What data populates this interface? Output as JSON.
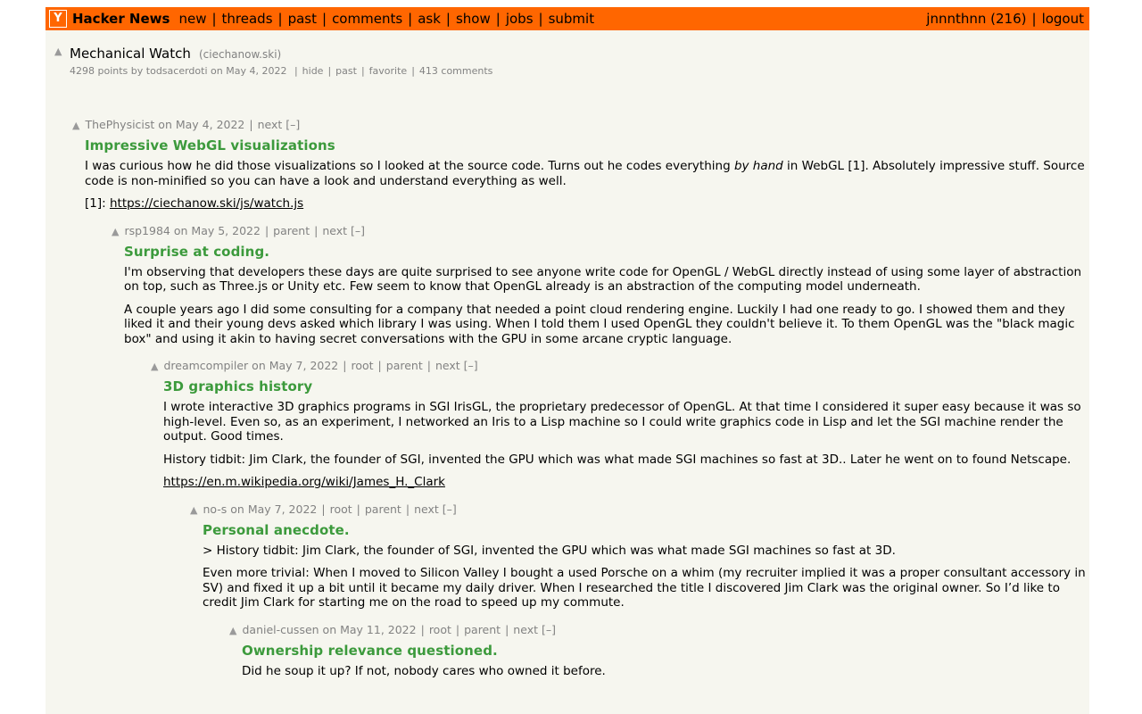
{
  "header": {
    "logo": "Y",
    "site_name": "Hacker News",
    "nav": [
      "new",
      "threads",
      "past",
      "comments",
      "ask",
      "show",
      "jobs",
      "submit"
    ],
    "user": "jnnnthnn (216)",
    "logout": "logout"
  },
  "story": {
    "title": "Mechanical Watch",
    "site": "(ciechanow.ski)",
    "points": "4298 points",
    "by_label": "by",
    "author": "todsacerdoti",
    "on_label": "on",
    "date": "May 4, 2022",
    "links": [
      "hide",
      "past",
      "favorite",
      "413 comments"
    ]
  },
  "comments": [
    {
      "author": "ThePhysicist",
      "date": "May 4, 2022",
      "links": [
        "next"
      ],
      "collapse": "[–]",
      "title": "Impressive WebGL visualizations",
      "paragraphs": [
        [
          {
            "t": "I was curious how he did those visualizations so I looked at the source code. Turns out he codes everything "
          },
          {
            "t": "by hand",
            "em": true
          },
          {
            "t": " in WebGL [1]. Absolutely impressive stuff. Source code is non-minified so you can have a look and understand everything as well."
          }
        ],
        [
          {
            "t": "[1]: "
          },
          {
            "t": "https://ciechanow.ski/js/watch.js",
            "link": true
          }
        ]
      ]
    },
    {
      "author": "rsp1984",
      "date": "May 5, 2022",
      "links": [
        "parent",
        "next"
      ],
      "collapse": "[–]",
      "title": "Surprise at coding.",
      "paragraphs": [
        [
          {
            "t": "I'm observing that developers these days are quite surprised to see anyone write code for OpenGL / WebGL directly instead of using some layer of abstraction on top, such as Three.js or Unity etc. Few seem to know that OpenGL already is an abstraction of the computing model underneath."
          }
        ],
        [
          {
            "t": "A couple years ago I did some consulting for a company that needed a point cloud rendering engine. Luckily I had one ready to go. I showed them and they liked it and their young devs asked which library I was using. When I told them I used OpenGL they couldn't believe it. To them OpenGL was the \"black magic box\" and using it akin to having secret conversations with the GPU in some arcane cryptic language."
          }
        ]
      ]
    },
    {
      "author": "dreamcompiler",
      "date": "May 7, 2022",
      "links": [
        "root",
        "parent",
        "next"
      ],
      "collapse": "[–]",
      "title": "3D graphics history",
      "paragraphs": [
        [
          {
            "t": "I wrote interactive 3D graphics programs in SGI IrisGL, the proprietary predecessor of OpenGL. At that time I considered it super easy because it was so high-level. Even so, as an experiment, I networked an Iris to a Lisp machine so I could write graphics code in Lisp and let the SGI machine render the output. Good times."
          }
        ],
        [
          {
            "t": "History tidbit: Jim Clark, the founder of SGI, invented the GPU which was what made SGI machines so fast at 3D.. Later he went on to found Netscape."
          }
        ],
        [
          {
            "t": "https://en.m.wikipedia.org/wiki/James_H._Clark",
            "link": true
          }
        ]
      ]
    },
    {
      "author": "no-s",
      "date": "May 7, 2022",
      "links": [
        "root",
        "parent",
        "next"
      ],
      "collapse": "[–]",
      "title": "Personal anecdote.",
      "paragraphs": [
        [
          {
            "t": "> History tidbit: Jim Clark, the founder of SGI, invented the GPU which was what made SGI machines so fast at 3D."
          }
        ],
        [
          {
            "t": "Even more trivial: When I moved to Silicon Valley I bought a used Porsche on a whim (my recruiter implied it was a proper consultant accessory in SV) and fixed it up a bit until it became my daily driver. When I researched the title I discovered Jim Clark was the original owner. So I’d like to credit Jim Clark for starting me on the road to speed up my commute."
          }
        ]
      ]
    },
    {
      "author": "daniel-cussen",
      "date": "May 11, 2022",
      "links": [
        "root",
        "parent",
        "next"
      ],
      "collapse": "[–]",
      "title": "Ownership relevance questioned.",
      "paragraphs": [
        [
          {
            "t": "Did he soup it up? If not, nobody cares who owned it before."
          }
        ]
      ]
    }
  ]
}
